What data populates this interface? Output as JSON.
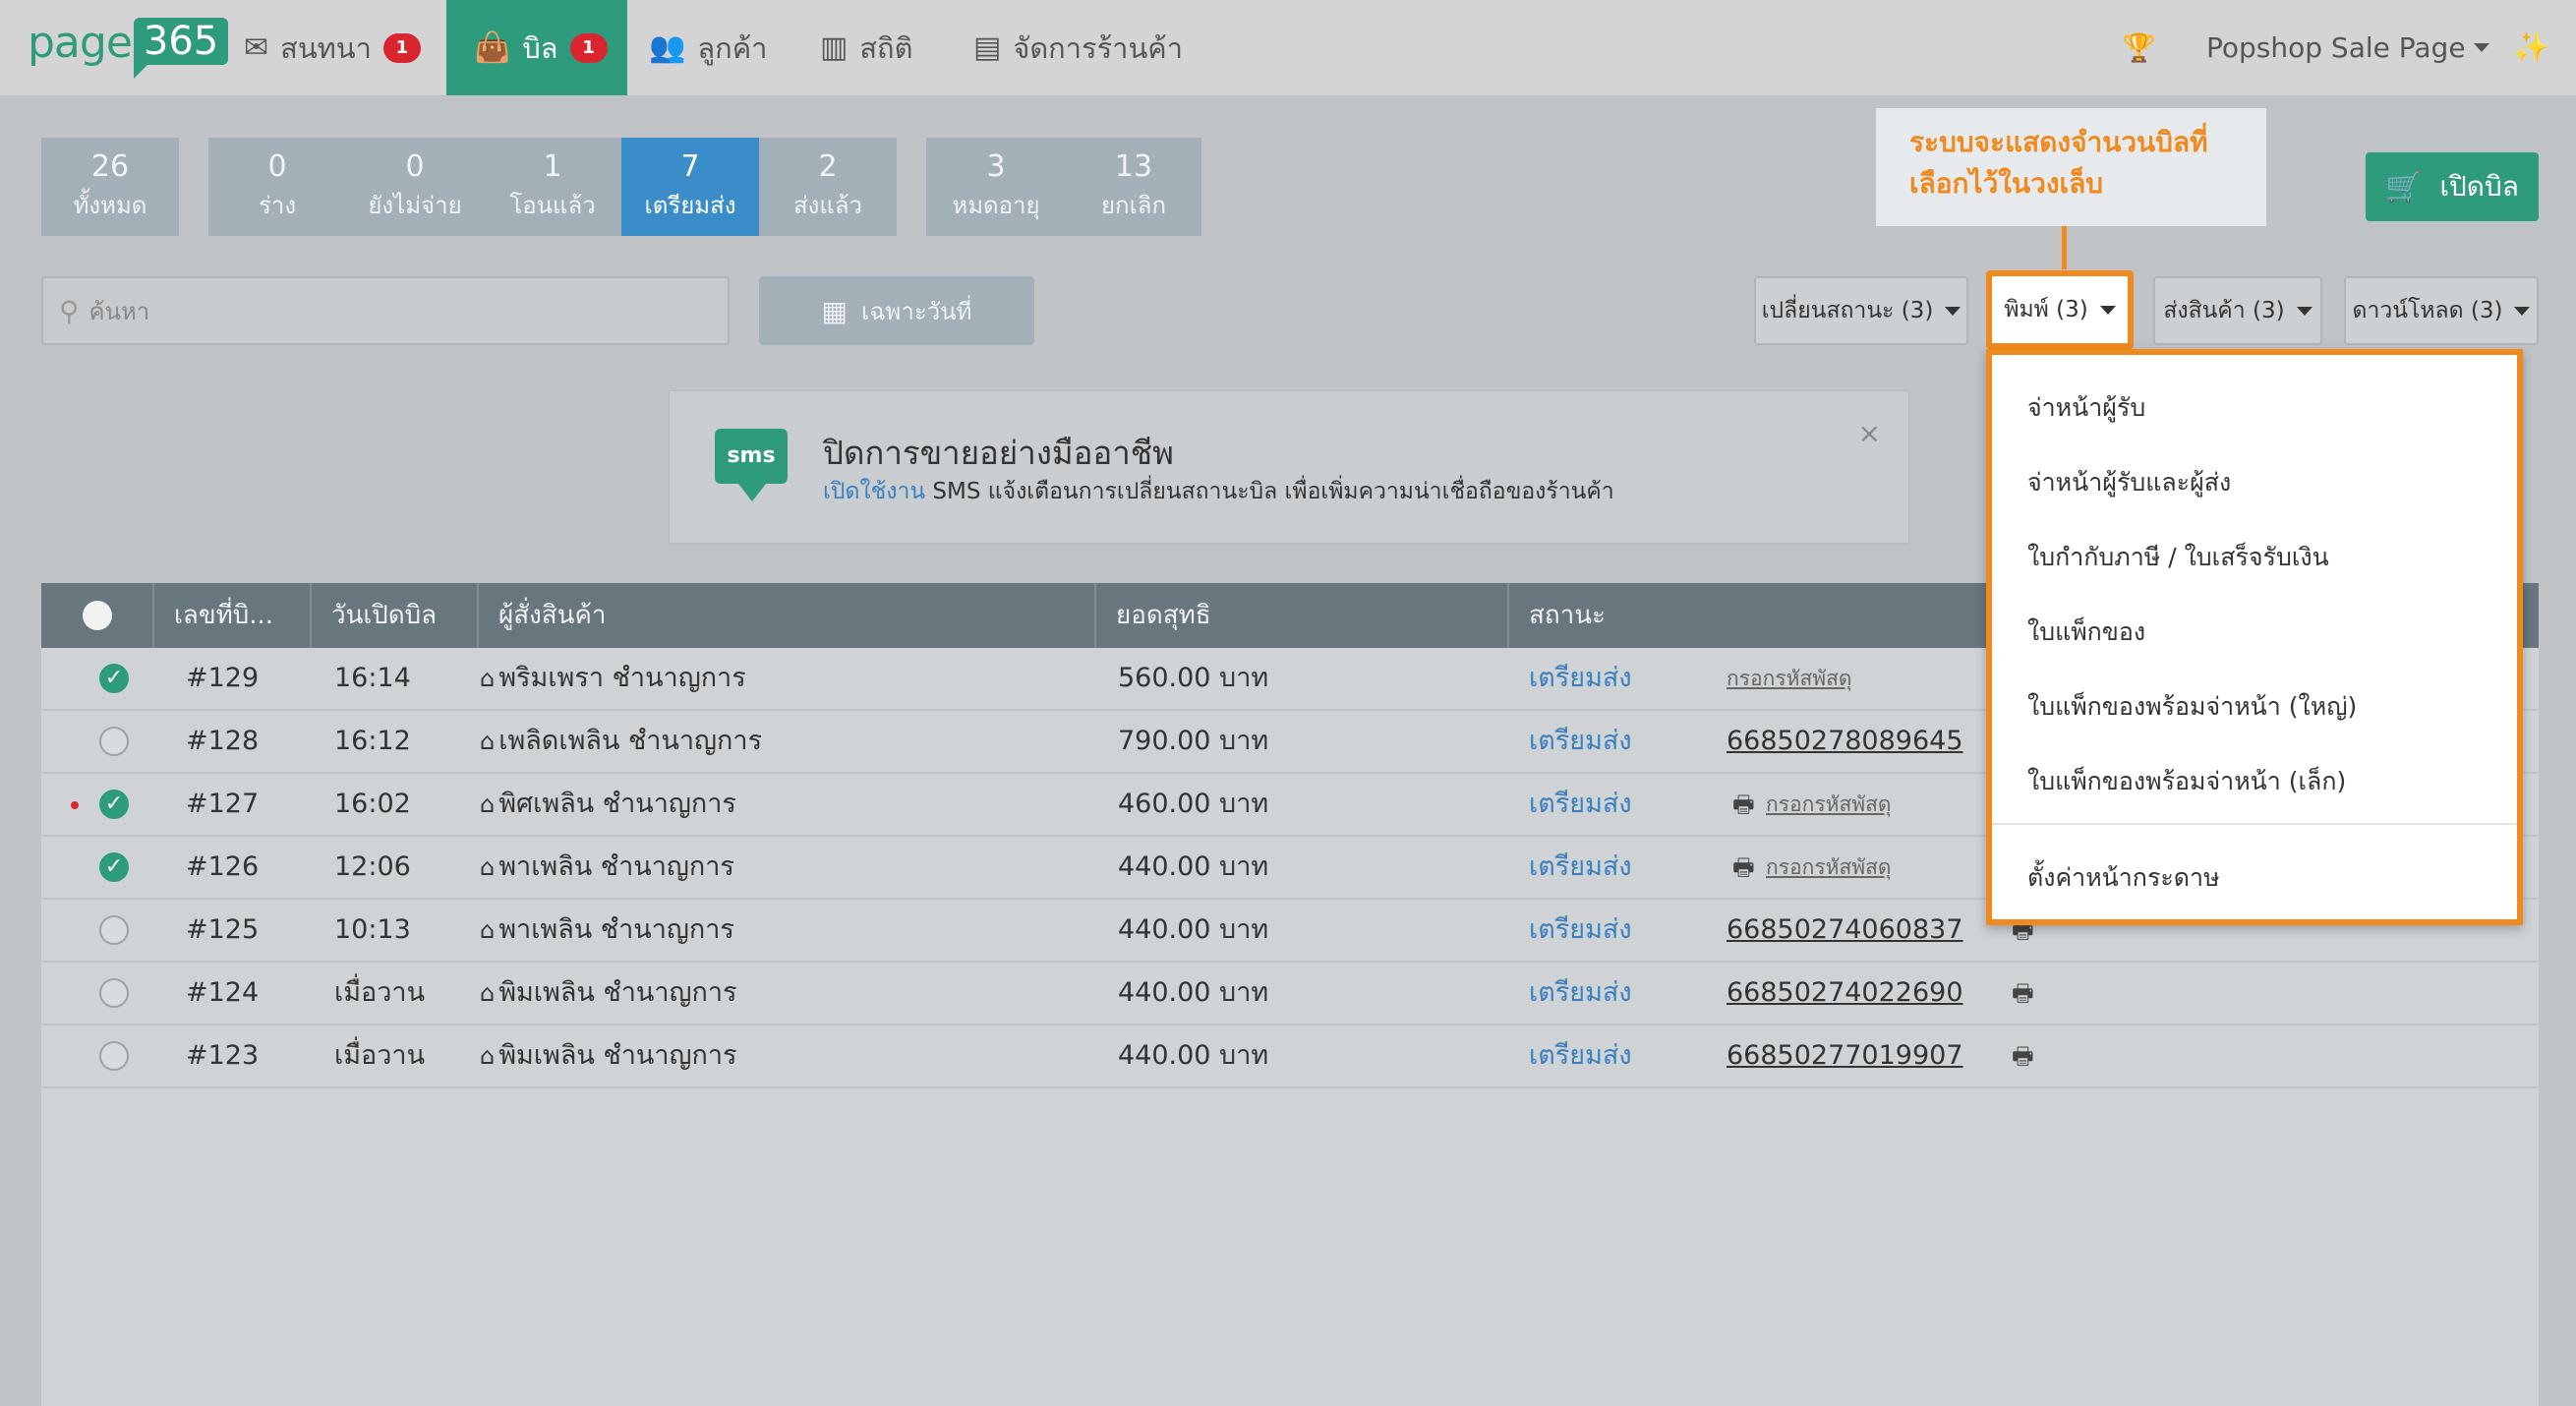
{
  "nav": {
    "logo_page": "page",
    "logo_num": "365",
    "chat": {
      "label": "สนทนา",
      "badge": "1"
    },
    "bill": {
      "label": "บิล",
      "badge": "1"
    },
    "customers": {
      "label": "ลูกค้า"
    },
    "stats": {
      "label": "สถิติ"
    },
    "shop": {
      "label": "จัดการร้านค้า"
    },
    "account": "Popshop Sale Page"
  },
  "status_tabs": [
    {
      "count": "26",
      "label": "ทั้งหมด"
    },
    {
      "count": "0",
      "label": "ร่าง"
    },
    {
      "count": "0",
      "label": "ยังไม่จ่าย"
    },
    {
      "count": "1",
      "label": "โอนแล้ว"
    },
    {
      "count": "7",
      "label": "เตรียมส่ง"
    },
    {
      "count": "2",
      "label": "ส่งแล้ว"
    },
    {
      "count": "3",
      "label": "หมดอายุ"
    },
    {
      "count": "13",
      "label": "ยกเลิก"
    }
  ],
  "callout": {
    "line1": "ระบบจะแสดงจำนวนบิลที่",
    "line2": "เลือกไว้ในวงเล็บ"
  },
  "open_bill_label": "เปิดบิล",
  "search": {
    "placeholder": "ค้นหา"
  },
  "date_filter_label": "เฉพาะวันที่",
  "actions": {
    "change_status": "เปลี่ยนสถานะ (3)",
    "print": "พิมพ์ (3)",
    "ship": "ส่งสินค้า (3)",
    "download": "ดาวน์โหลด (3)"
  },
  "print_menu": [
    "จ่าหน้าผู้รับ",
    "จ่าหน้าผู้รับและผู้ส่ง",
    "ใบกำกับภาษี / ใบเสร็จรับเงิน",
    "ใบแพ็กของ",
    "ใบแพ็กของพร้อมจ่าหน้า (ใหญ่)",
    "ใบแพ็กของพร้อมจ่าหน้า (เล็ก)",
    "ตั้งค่าหน้ากระดาษ"
  ],
  "sms_banner": {
    "title": "ปิดการขายอย่างมืออาชีพ",
    "link": "เปิดใช้งาน",
    "desc": " SMS แจ้งเตือนการเปลี่ยนสถานะบิล เพื่อเพิ่มความน่าเชื่อถือของร้านค้า",
    "icon_text": "sms",
    "close": "×"
  },
  "table": {
    "headers": {
      "bill_no": "เลขที่บิ...",
      "date": "วันเปิดบิล",
      "customer": "ผู้สั่งสินค้า",
      "total": "ยอดสุทธิ",
      "status": "สถานะ"
    },
    "rows": [
      {
        "no": "#129",
        "time": "16:14",
        "name": "พริมเพรา ชำนาญการ",
        "total": "560.00 บาท",
        "status": "เตรียมส่ง",
        "tracking": "กรอกรหัสพัสดุ",
        "checked": true
      },
      {
        "no": "#128",
        "time": "16:12",
        "name": "เพลิดเพลิน ชำนาญการ",
        "total": "790.00 บาท",
        "status": "เตรียมส่ง",
        "tracking": "66850278089645",
        "checked": false
      },
      {
        "no": "#127",
        "time": "16:02",
        "name": "พิศเพลิน ชำนาญการ",
        "total": "460.00 บาท",
        "status": "เตรียมส่ง",
        "tracking": "กรอกรหัสพัสดุ",
        "checked": true
      },
      {
        "no": "#126",
        "time": "12:06",
        "name": "พาเพลิน ชำนาญการ",
        "total": "440.00 บาท",
        "status": "เตรียมส่ง",
        "tracking": "กรอกรหัสพัสดุ",
        "checked": true
      },
      {
        "no": "#125",
        "time": "10:13",
        "name": "พาเพลิน ชำนาญการ",
        "total": "440.00 บาท",
        "status": "เตรียมส่ง",
        "tracking": "66850274060837",
        "checked": false
      },
      {
        "no": "#124",
        "time": "เมื่อวาน",
        "name": "พิมเพลิน ชำนาญการ",
        "total": "440.00 บาท",
        "status": "เตรียมส่ง",
        "tracking": "66850274022690",
        "checked": false
      },
      {
        "no": "#123",
        "time": "เมื่อวาน",
        "name": "พิมเพลิน ชำนาญการ",
        "total": "440.00 บาท",
        "status": "เตรียมส่ง",
        "tracking": "66850277019907",
        "checked": false
      }
    ]
  },
  "colors": {
    "brand": "#2e9b7d",
    "active_tab": "#3a8dc8",
    "highlight": "#f08a1e",
    "badge": "#d9262e"
  }
}
